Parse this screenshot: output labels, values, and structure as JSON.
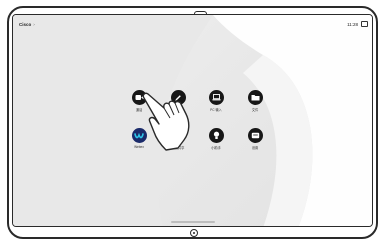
{
  "header": {
    "brand": "Cisco",
    "brand_chevron": "›",
    "time": "11:28",
    "status_icon": "screen-icon"
  },
  "apps": [
    {
      "label": "通话",
      "icon": "video-camera-icon",
      "color": "#171717"
    },
    {
      "label": "",
      "icon": "pen-icon",
      "color": "#171717"
    },
    {
      "label": "PC 输入",
      "icon": "laptop-icon",
      "color": "#171717"
    },
    {
      "label": "文件",
      "icon": "folder-icon",
      "color": "#171717"
    },
    {
      "label": "Webex",
      "icon": "webex-icon",
      "color": "#1a2a6a"
    },
    {
      "label": "无线共享",
      "icon": "share-icon",
      "color": "#171717"
    },
    {
      "label": "小助手",
      "icon": "lightbulb-icon",
      "color": "#171717"
    },
    {
      "label": "设置",
      "icon": "message-icon",
      "color": "#171717"
    }
  ],
  "overlay": {
    "icon": "pointing-hand-icon"
  },
  "device": {
    "home_button": "home-button-icon"
  }
}
